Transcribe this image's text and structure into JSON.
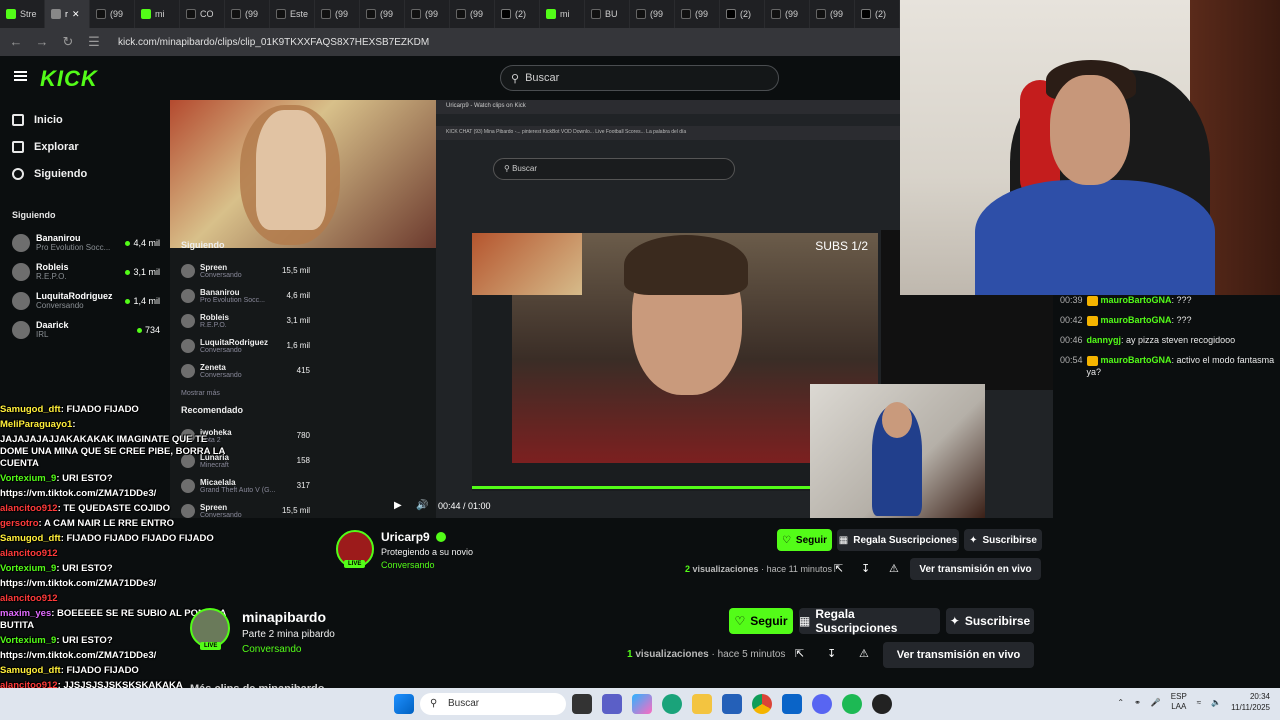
{
  "browser": {
    "tabs": [
      {
        "label": "Stre",
        "kind": "kick"
      },
      {
        "label": "r",
        "kind": "active"
      },
      {
        "label": "(99",
        "kind": "tt"
      },
      {
        "label": "mi",
        "kind": "kick"
      },
      {
        "label": "CO",
        "kind": "tt"
      },
      {
        "label": "(99",
        "kind": "tt"
      },
      {
        "label": "Este",
        "kind": "tt"
      },
      {
        "label": "(99",
        "kind": "tt"
      },
      {
        "label": "(99",
        "kind": "tt"
      },
      {
        "label": "(99",
        "kind": "tt"
      },
      {
        "label": "(99",
        "kind": "tt"
      },
      {
        "label": "(2)",
        "kind": "x"
      },
      {
        "label": "mi",
        "kind": "kick"
      },
      {
        "label": "BU",
        "kind": "tt"
      },
      {
        "label": "(99",
        "kind": "tt"
      },
      {
        "label": "(99",
        "kind": "tt"
      },
      {
        "label": "(2)",
        "kind": "x"
      },
      {
        "label": "(99",
        "kind": "tt"
      },
      {
        "label": "(99",
        "kind": "tt"
      },
      {
        "label": "(2)",
        "kind": "x"
      }
    ],
    "url": "kick.com/minapibardo/clips/clip_01K9TKXXFAQS8X7HEXSB7EZKDM"
  },
  "kick": {
    "logo": "KICK",
    "search_placeholder": "Buscar",
    "nav": [
      {
        "label": "Inicio",
        "icon": "home-icon"
      },
      {
        "label": "Explorar",
        "icon": "compass-icon"
      },
      {
        "label": "Siguiendo",
        "icon": "heart-icon"
      }
    ],
    "following_title": "Siguiendo",
    "following": [
      {
        "name": "Bananirou",
        "category": "Pro Evolution Socc...",
        "viewers": "4,4 mil"
      },
      {
        "name": "Robleis",
        "category": "R.E.P.O.",
        "viewers": "3,1 mil"
      },
      {
        "name": "LuquitaRodriguez",
        "category": "Conversando",
        "viewers": "1,4 mil"
      },
      {
        "name": "Daarick",
        "category": "IRL",
        "viewers": "734"
      }
    ]
  },
  "inner": {
    "tab_label": "Uricarp9 - Watch clips on Kick",
    "bookmarks": "KICK CHAT   (93) Mina Pibardo -...   pinterest   KickBot VOD Downlo...   Live Football Scores...   La palabra del día",
    "search": "Buscar",
    "sidebar_title": "Siguiendo",
    "sidebar": [
      {
        "name": "Spreen",
        "category": "Conversando",
        "viewers": "15,5 mil"
      },
      {
        "name": "Bananirou",
        "category": "Pro Evolution Socc...",
        "viewers": "4,6 mil"
      },
      {
        "name": "Robleis",
        "category": "R.E.P.O.",
        "viewers": "3,1 mil"
      },
      {
        "name": "LuquitaRodriguez",
        "category": "Conversando",
        "viewers": "1,6 mil"
      },
      {
        "name": "Zeneta",
        "category": "Conversando",
        "viewers": "415"
      }
    ],
    "show_more": "Mostrar más",
    "recommended_title": "Recomendado",
    "recommended": [
      {
        "name": "iwoheka",
        "category": "Dota 2",
        "viewers": "780"
      },
      {
        "name": "Lunaria",
        "category": "Minecraft",
        "viewers": "158"
      },
      {
        "name": "Micaelala",
        "category": "Grand Theft Auto V (G...",
        "viewers": "317"
      },
      {
        "name": "Spreen",
        "category": "Conversando",
        "viewers": "15,5 mil"
      },
      {
        "name": "Syztmz",
        "category": "Slots & Casino",
        "viewers": "4,8 mil"
      }
    ],
    "subs_badge": "SUBS 1/2",
    "time": "00:44 / 01:00"
  },
  "overlay_chat": [
    {
      "user": "Samugod_dft",
      "color": "y",
      "msg": ": FIJADO FIJADO"
    },
    {
      "user": "MeliParaguayo1",
      "color": "y",
      "msg": ":"
    },
    {
      "user": "",
      "color": "y",
      "msg": "JAJAJAJAJJAKAKAKAK IMAGINATE QUE TE DOME UNA MINA QUE SE CREE PIBE, BORRA LA CUENTA"
    },
    {
      "user": "Vortexium_9",
      "color": "g",
      "msg": ": URI ESTO?"
    },
    {
      "user": "",
      "color": "y",
      "msg": "https://vm.tiktok.com/ZMA71DDe3/"
    },
    {
      "user": "alancitoo912",
      "color": "r",
      "msg": ": TE QUEDASTE COJIDO"
    },
    {
      "user": "gersotro",
      "color": "r",
      "msg": ": A CAM NAIR LE RRE ENTRO"
    },
    {
      "user": "Samugod_dft",
      "color": "y",
      "msg": ": FIJADO FIJADO FIJADO FIJADO"
    },
    {
      "user": "alancitoo912",
      "color": "r",
      "msg": ""
    },
    {
      "user": "Vortexium_9",
      "color": "g",
      "msg": ": URI ESTO?"
    },
    {
      "user": "",
      "color": "y",
      "msg": "https://vm.tiktok.com/ZMA71DDe3/"
    },
    {
      "user": "alancitoo912",
      "color": "r",
      "msg": ""
    },
    {
      "user": "maxim_yes",
      "color": "m",
      "msg": ": BOEEEEE SE RE SUBIO AL PONY LA BUTITA"
    },
    {
      "user": "Vortexium_9",
      "color": "g",
      "msg": ": URI ESTO?"
    },
    {
      "user": "",
      "color": "y",
      "msg": "https://vm.tiktok.com/ZMA71DDe3/"
    },
    {
      "user": "Samugod_dft",
      "color": "y",
      "msg": ": FIJADO FIJADO"
    },
    {
      "user": "alancitoo912",
      "color": "r",
      "msg": ": JJSJSJSJSKSKSKAKAKA"
    }
  ],
  "right_chat": [
    {
      "time": "00:39",
      "user": "mauroBartoGNA",
      "msg": ": ???",
      "badge": true
    },
    {
      "time": "00:42",
      "user": "mauroBartoGNA",
      "msg": ": ???",
      "badge": true
    },
    {
      "time": "00:46",
      "user": "dannygj",
      "msg": ": ay pizza steven recogidooo",
      "badge": false
    },
    {
      "time": "00:54",
      "user": "mauroBartoGNA",
      "msg": ": activo el modo fantasma ya?",
      "badge": true
    }
  ],
  "clip1": {
    "channel": "Uricarp9",
    "title": "Protegiendo a su novio",
    "category": "Conversando",
    "live": "LIVE",
    "follow": "Seguir",
    "gift": "Regala Suscripciones",
    "subscribe": "Suscribirse",
    "views_count": "2",
    "views_label": "visualizaciones",
    "age": "hace 11 minutos",
    "watch_live": "Ver transmisión en vivo"
  },
  "clip2": {
    "channel": "minapibardo",
    "title": "Parte 2 mina pibardo",
    "category": "Conversando",
    "live": "LIVE",
    "follow": "Seguir",
    "gift": "Regala Suscripciones",
    "subscribe": "Suscribirse",
    "views_count": "1",
    "views_label": "visualizaciones",
    "age": "hace 5 minutos",
    "watch_live": "Ver transmisión en vivo",
    "more_title": "Más clips de minapibardo"
  },
  "taskbar": {
    "search": "Buscar",
    "lang1": "ESP",
    "lang2": "LAA",
    "time": "20:34",
    "date": "11/11/2025"
  },
  "colors": {
    "kick_green": "#53fc18",
    "background": "#0b0e0f",
    "taskbar": "#dfe5ee"
  }
}
